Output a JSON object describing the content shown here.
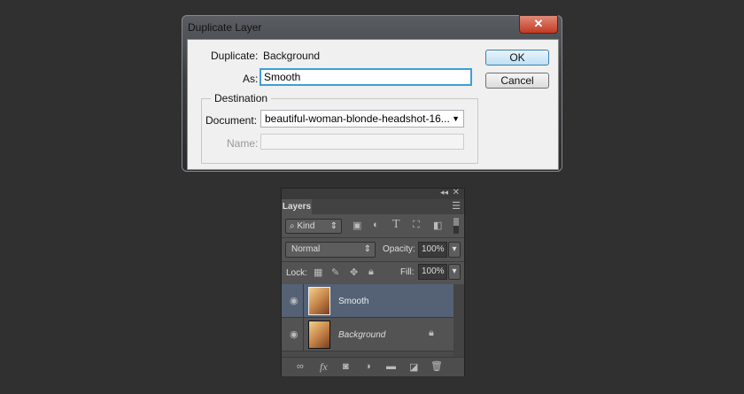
{
  "dialog": {
    "title": "Duplicate Layer",
    "close": "✕",
    "duplicate_label": "Duplicate:",
    "duplicate_value": "Background",
    "as_label": "As:",
    "as_value": "Smooth",
    "ok": "OK",
    "cancel": "Cancel",
    "destination": "Destination",
    "document_label": "Document:",
    "document_value": "beautiful-woman-blonde-headshot-16...",
    "name_label": "Name:",
    "name_value": ""
  },
  "layers": {
    "tab": "Layers",
    "filter": "Kind",
    "blend": "Normal",
    "opacity_label": "Opacity:",
    "opacity": "100%",
    "lock_label": "Lock:",
    "fill_label": "Fill:",
    "fill": "100%",
    "items": [
      {
        "name": "Smooth",
        "selected": true
      },
      {
        "name": "Background",
        "locked": true
      }
    ],
    "footer_fx": "fx"
  }
}
